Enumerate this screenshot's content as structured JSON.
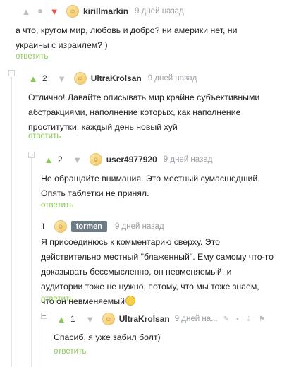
{
  "comments": [
    {
      "id": "c1",
      "author": "kirillmarkin",
      "time": "9 дней назад",
      "text": "а что, кругом мир, любовь и добро? ни америки нет, ни украины с израилем? )",
      "reply_label": "ответить",
      "rating": ""
    },
    {
      "id": "c2",
      "author": "UltraKrolsan",
      "time": "9 дней назад",
      "rating": "2",
      "text": "Отлично! Давайте описывать мир крайне субъективными абстракциями, наполнение которых, как наполнение проститутки, каждый день новый хуй",
      "reply_label": "ответить"
    },
    {
      "id": "c3",
      "author": "user4977920",
      "time": "9 дней назад",
      "rating": "2",
      "text": "Не обращайте внимания. Это местный сумасшедший. Опять таблетки не принял.",
      "reply_label": "ответить"
    },
    {
      "id": "c4",
      "author": "tormen",
      "time": "9 дней назад",
      "rating": "1",
      "text": "Я присоединюсь к комментарию сверху. Это действительно местный \"блаженный\". Ему самому что-то доказывать бессмысленно, он невменяемый, и аудитории тоже не нужно, потому, что мы тоже знаем, что он невменяемый",
      "reply_label": "ответить"
    },
    {
      "id": "c5",
      "author": "UltraKrolsan",
      "time": "9 дней на...",
      "rating": "1",
      "text": "Спасиб, я уже забил болт)",
      "reply_label": "ответить"
    }
  ],
  "icons": {
    "vote_up": "triangle-up-icon",
    "vote_down": "triangle-down-icon",
    "avatar": "avatar-icon",
    "emoji": "slightly-smiling-emoji-icon"
  },
  "colors": {
    "accent_green": "#8ac858",
    "vote_down_red": "#e9564c",
    "muted": "#9aa0a6",
    "badge": "#6d7b84"
  }
}
